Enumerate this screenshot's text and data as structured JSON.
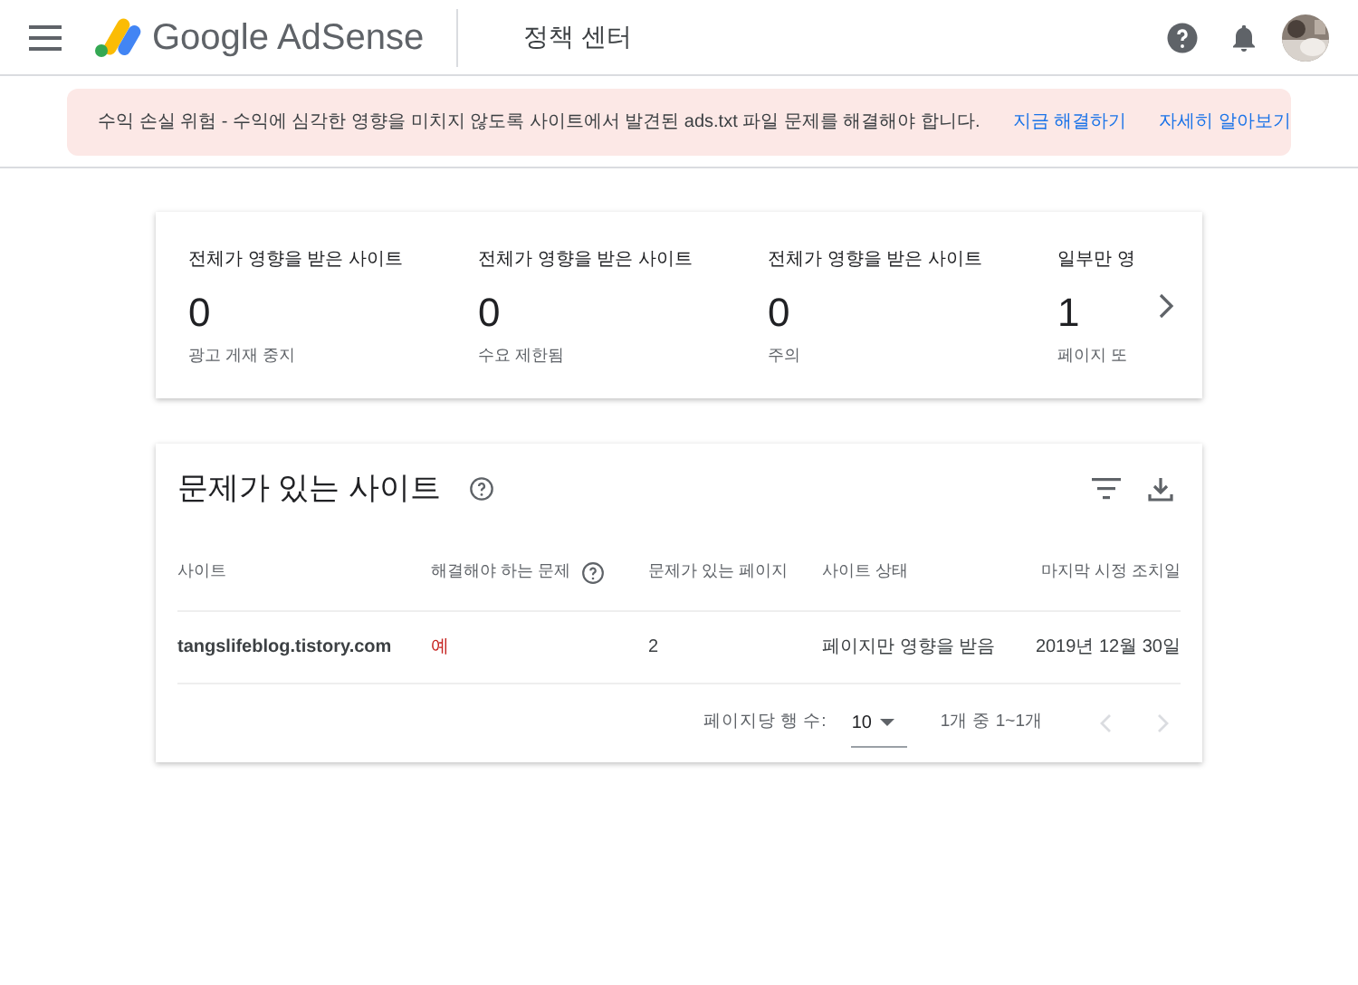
{
  "header": {
    "product": "Google AdSense",
    "section": "정책 센터"
  },
  "banner": {
    "message": "수익 손실 위험 - 수익에 심각한 영향을 미치지 않도록 사이트에서 발견된 ads.txt 파일 문제를 해결해야 합니다.",
    "actions": [
      "지금 해결하기",
      "자세히 알아보기"
    ]
  },
  "stats": [
    {
      "title": "전체가 영향을 받은 사이트",
      "value": "0",
      "caption": "광고 게재 중지"
    },
    {
      "title": "전체가 영향을 받은 사이트",
      "value": "0",
      "caption": "수요 제한됨"
    },
    {
      "title": "전체가 영향을 받은 사이트",
      "value": "0",
      "caption": "주의"
    },
    {
      "title": "일부만 영",
      "value": "1",
      "caption": "페이지 또"
    }
  ],
  "table": {
    "title": "문제가 있는 사이트",
    "columns": [
      "사이트",
      "해결해야 하는 문제",
      "문제가 있는 페이지",
      "사이트 상태",
      "마지막 시정 조치일"
    ],
    "rows": [
      [
        "tangslifeblog.tistory.com",
        "예",
        "2",
        "페이지만 영향을 받음",
        "2019년 12월 30일"
      ]
    ],
    "rows_per_page_label": "페이지당 행 수:",
    "rows_per_page": "10",
    "range": "1개 중 1~1개",
    "prev_disabled": true,
    "next_disabled": true
  }
}
